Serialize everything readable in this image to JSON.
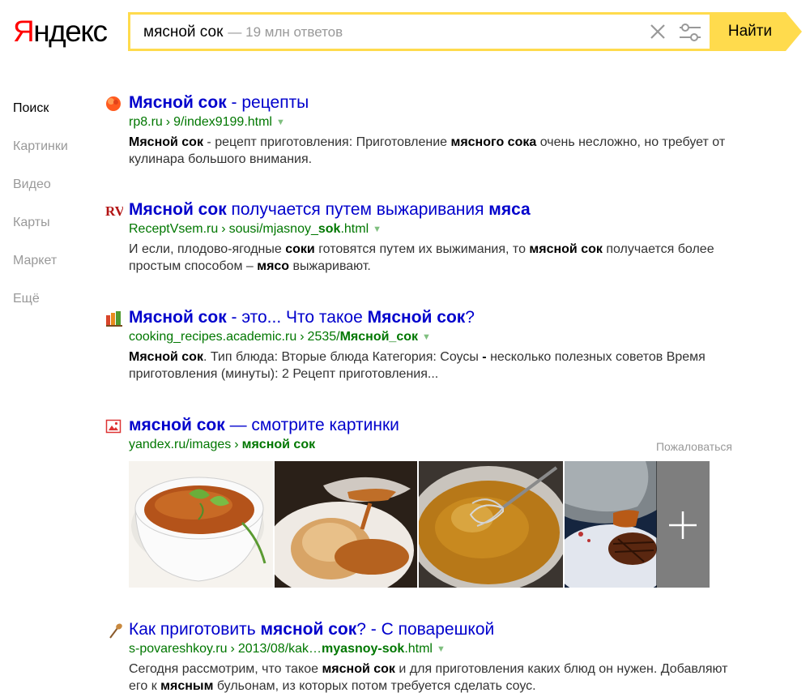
{
  "logo": {
    "first_letter": "Я",
    "rest": "ндекс"
  },
  "search": {
    "query": "мясной сок",
    "hint": "— 19 млн ответов",
    "button_label": "Найти"
  },
  "nav": [
    {
      "label": "Поиск",
      "active": true
    },
    {
      "label": "Картинки"
    },
    {
      "label": "Видео"
    },
    {
      "label": "Карты"
    },
    {
      "label": "Маркет"
    },
    {
      "label": "Ещё"
    }
  ],
  "results": [
    {
      "favicon": "orange-circle-icon",
      "title": [
        [
          "Мясной сок",
          true
        ],
        [
          " - рецепты",
          false
        ]
      ],
      "url": [
        [
          "rp8.ru",
          false
        ],
        [
          "›",
          "sep"
        ],
        [
          "9/index9199.html",
          false
        ]
      ],
      "snippet": [
        [
          "Мясной сок",
          true
        ],
        [
          " - рецепт приготовления: Приготовление ",
          false
        ],
        [
          "мясного сока",
          true
        ],
        [
          " очень несложно, но требует от кулинара большого внимания.",
          false
        ]
      ]
    },
    {
      "favicon": "rv-logo-icon",
      "title": [
        [
          "Мясной сок",
          true
        ],
        [
          " получается путем выжаривания ",
          false
        ],
        [
          "мяса",
          true
        ]
      ],
      "url": [
        [
          "ReceptVsem.ru",
          false
        ],
        [
          "›",
          "sep"
        ],
        [
          "sousi/mjasnoy_",
          false
        ],
        [
          "sok",
          true
        ],
        [
          ".html",
          false
        ]
      ],
      "snippet": [
        [
          "И если, плодово-ягодные ",
          false
        ],
        [
          "соки",
          true
        ],
        [
          " готовятся путем их выжимания, то ",
          false
        ],
        [
          "мясной сок",
          true
        ],
        [
          " получается более простым способом – ",
          false
        ],
        [
          "мясо",
          true
        ],
        [
          " выжаривают.",
          false
        ]
      ]
    },
    {
      "favicon": "books-icon",
      "title": [
        [
          "Мясной сок",
          true
        ],
        [
          " - это... Что такое ",
          false
        ],
        [
          "Мясной сок",
          true
        ],
        [
          "?",
          false
        ]
      ],
      "url": [
        [
          "cooking_recipes.academic.ru",
          false
        ],
        [
          "›",
          "sep"
        ],
        [
          "2535/",
          false
        ],
        [
          "Мясной_сок",
          true
        ]
      ],
      "snippet": [
        [
          "Мясной сок",
          true
        ],
        [
          ". Тип блюда: Вторые блюда Категория: Соусы ",
          false
        ],
        [
          "-",
          true
        ],
        [
          " несколько полезных советов Время приготовления (минуты): 2 Рецепт приготовления...",
          false
        ]
      ]
    },
    {
      "favicon": "image-icon",
      "title": [
        [
          "мясной сок",
          true
        ],
        [
          " — смотрите картинки",
          false
        ]
      ],
      "url": [
        [
          "yandex.ru/images",
          false
        ],
        [
          "›",
          "sep"
        ],
        [
          "мясной сок",
          true
        ]
      ],
      "complain": "Пожаловаться",
      "images": [
        "soup-bowl-photo",
        "chicken-gravy-photo",
        "whisk-pan-photo",
        "steak-sauce-photo"
      ]
    },
    {
      "favicon": "ladle-icon",
      "title": [
        [
          "Как приготовить ",
          false
        ],
        [
          "мясной сок",
          true
        ],
        [
          "? - С поварешкой",
          false
        ]
      ],
      "url": [
        [
          "s-povareshkoy.ru",
          false
        ],
        [
          "›",
          "sep"
        ],
        [
          "2013/08/kak…",
          false
        ],
        [
          "myasnoy-sok",
          true
        ],
        [
          ".html",
          false
        ]
      ],
      "snippet": [
        [
          "Сегодня рассмотрим, что такое ",
          false
        ],
        [
          "мясной сок",
          true
        ],
        [
          " и для приготовления каких блюд он нужен. Добавляют его к ",
          false
        ],
        [
          "мясным",
          true
        ],
        [
          " бульонам, из которых потом требуется сделать соус.",
          false
        ]
      ]
    }
  ]
}
